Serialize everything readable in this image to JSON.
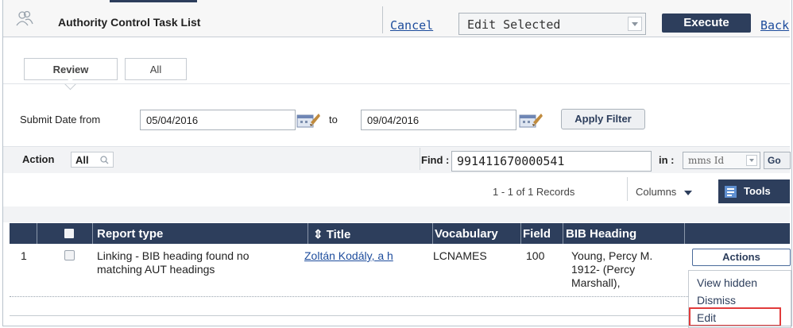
{
  "header": {
    "title": "Authority Control Task List",
    "cancel": "Cancel",
    "bulk_action": "Edit Selected",
    "execute": "Execute",
    "back": "Back"
  },
  "tabs": [
    {
      "label": "Review",
      "active": true
    },
    {
      "label": "All",
      "active": false
    }
  ],
  "filter": {
    "submit_date_label": "Submit Date from",
    "date_from": "05/04/2016",
    "to_label": "to",
    "date_to": "09/04/2016",
    "apply": "Apply Filter"
  },
  "toolbar": {
    "action_label": "Action",
    "action_value": "All",
    "find_label": "Find :",
    "find_value": "991411670000541",
    "in_label": "in :",
    "in_value": "mms Id",
    "go": "Go",
    "records": "1 - 1 of 1 Records",
    "columns": "Columns",
    "tools": "Tools"
  },
  "table": {
    "headers": {
      "report_type": "Report type",
      "title": "⇕ Title",
      "vocabulary": "Vocabulary",
      "field": "Field",
      "bib_heading": "BIB Heading"
    },
    "rows": [
      {
        "num": "1",
        "report_type_l1": "Linking - BIB heading found no",
        "report_type_l2": "matching AUT headings",
        "title": "Zoltán Kodály, a h",
        "vocabulary": "LCNAMES",
        "field": "100",
        "heading_l1": "Young, Percy M.",
        "heading_l2": "1912- (Percy",
        "heading_l3": "Marshall),"
      }
    ],
    "actions": "Actions",
    "menu": [
      "View hidden",
      "Dismiss",
      "Edit"
    ]
  },
  "colors": {
    "navy": "#2d3e5c",
    "link": "#1d4c9c",
    "highlight": "#e13b3b"
  },
  "icons": [
    "users-icon",
    "calendar-icon",
    "search-icon",
    "tools-icon",
    "dropdown-arrow-icon"
  ]
}
